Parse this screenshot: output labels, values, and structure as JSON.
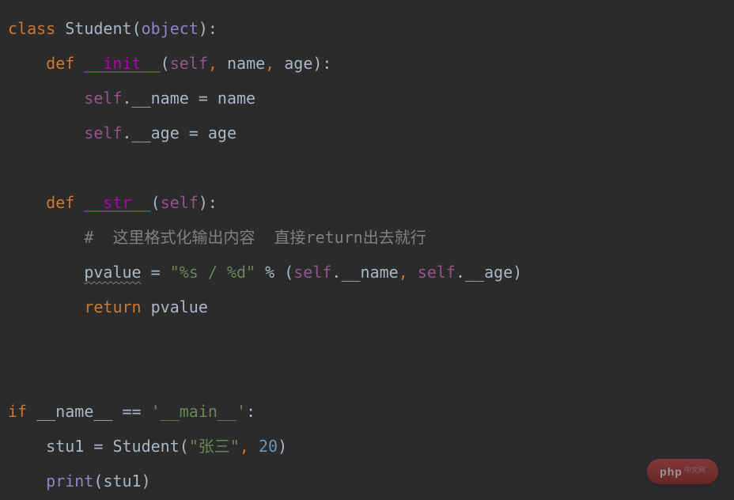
{
  "code": {
    "line1": {
      "kw_class": "class",
      "class_name": "Student",
      "paren_open": "(",
      "object": "object",
      "paren_close": ")",
      "colon": ":"
    },
    "line2": {
      "indent": "    ",
      "kw_def": "def",
      "method": "__init__",
      "paren_open": "(",
      "self": "self",
      "comma1": ",",
      "name": "name",
      "comma2": ",",
      "age": "age",
      "paren_close": ")",
      "colon": ":"
    },
    "line3": {
      "indent": "        ",
      "self": "self",
      "dot": ".",
      "attr": "__name",
      "eq": " = ",
      "val": "name"
    },
    "line4": {
      "indent": "        ",
      "self": "self",
      "dot": ".",
      "attr": "__age",
      "eq": " = ",
      "val": "age"
    },
    "line5": {
      "blank": ""
    },
    "line6": {
      "indent": "    ",
      "kw_def": "def",
      "method": "__str__",
      "paren_open": "(",
      "self": "self",
      "paren_close": ")",
      "colon": ":"
    },
    "line7": {
      "indent": "        ",
      "comment": "#  这里格式化输出内容  直接return出去就行"
    },
    "line8": {
      "indent": "        ",
      "var": "pvalue",
      "eq": " = ",
      "fmt_str": "\"%s / %d\"",
      "pct": " % ",
      "paren_open": "(",
      "self1": "self",
      "dot1": ".",
      "attr1": "__name",
      "comma": ",",
      "self2": "self",
      "dot2": ".",
      "attr2": "__age",
      "paren_close": ")"
    },
    "line9": {
      "indent": "        ",
      "kw_return": "return",
      "var": "pvalue"
    },
    "line10": {
      "blank": ""
    },
    "line11": {
      "blank": ""
    },
    "line12": {
      "kw_if": "if",
      "dunder_name": "__name__",
      "eq": " == ",
      "main_str": "'__main__'",
      "colon": ":"
    },
    "line13": {
      "indent": "    ",
      "var": "stu1",
      "eq": " = ",
      "cls": "Student",
      "paren_open": "(",
      "name_str": "\"张三\"",
      "comma": ",",
      "age": "20",
      "paren_close": ")"
    },
    "line14": {
      "indent": "    ",
      "print": "print",
      "paren_open": "(",
      "var": "stu1",
      "paren_close": ")"
    }
  },
  "watermark": {
    "main": "php",
    "sub": "中文网"
  }
}
